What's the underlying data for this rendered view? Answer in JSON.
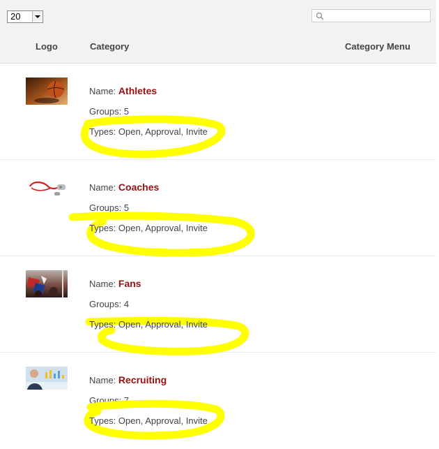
{
  "controls": {
    "page_size_value": "20",
    "search_placeholder": "",
    "search_value": ""
  },
  "columns": {
    "logo": "Logo",
    "category": "Category",
    "category_menu": "Category Menu"
  },
  "rows": [
    {
      "name_label": "Name:",
      "name": "Athletes",
      "groups": "Groups: 5",
      "types": "Types: Open, Approval, Invite",
      "logo_icon": "basketball-photo"
    },
    {
      "name_label": "Name:",
      "name": "Coaches",
      "groups": "Groups: 5",
      "types": "Types: Open, Approval, Invite",
      "logo_icon": "whistle-photo"
    },
    {
      "name_label": "Name:",
      "name": "Fans",
      "groups": "Groups: 4",
      "types": "Types: Open, Approval, Invite",
      "logo_icon": "fans-crowd-photo"
    },
    {
      "name_label": "Name:",
      "name": "Recruiting",
      "groups": "Groups: 7",
      "types": "Types: Open, Approval, Invite",
      "logo_icon": "recruiter-photo"
    }
  ],
  "colors": {
    "highlight": "#ffff00",
    "name_link": "#9a0f0f",
    "header_bg": "#f2f2f2"
  }
}
